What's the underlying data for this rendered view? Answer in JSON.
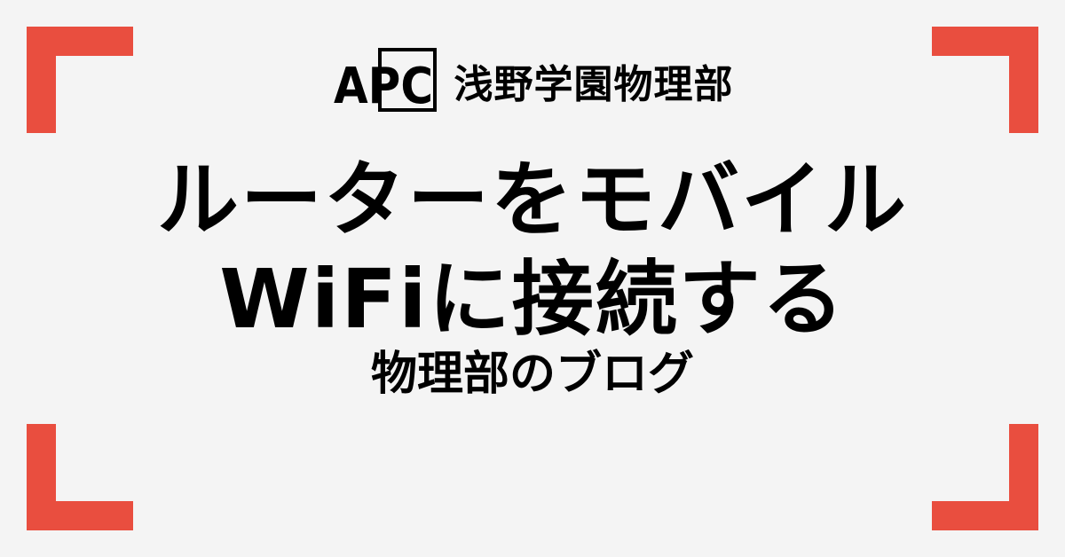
{
  "colors": {
    "background": "#f4f4f4",
    "frame_accent": "#e94e3f",
    "text": "#000000"
  },
  "header": {
    "logo_text": "APC",
    "logo_icon": "apc-logo-icon",
    "org_name": "浅野学園物理部"
  },
  "title": {
    "line1": "ルーターをモバイル",
    "line2": "WiFiに接続する"
  },
  "subtitle": "物理部のブログ"
}
